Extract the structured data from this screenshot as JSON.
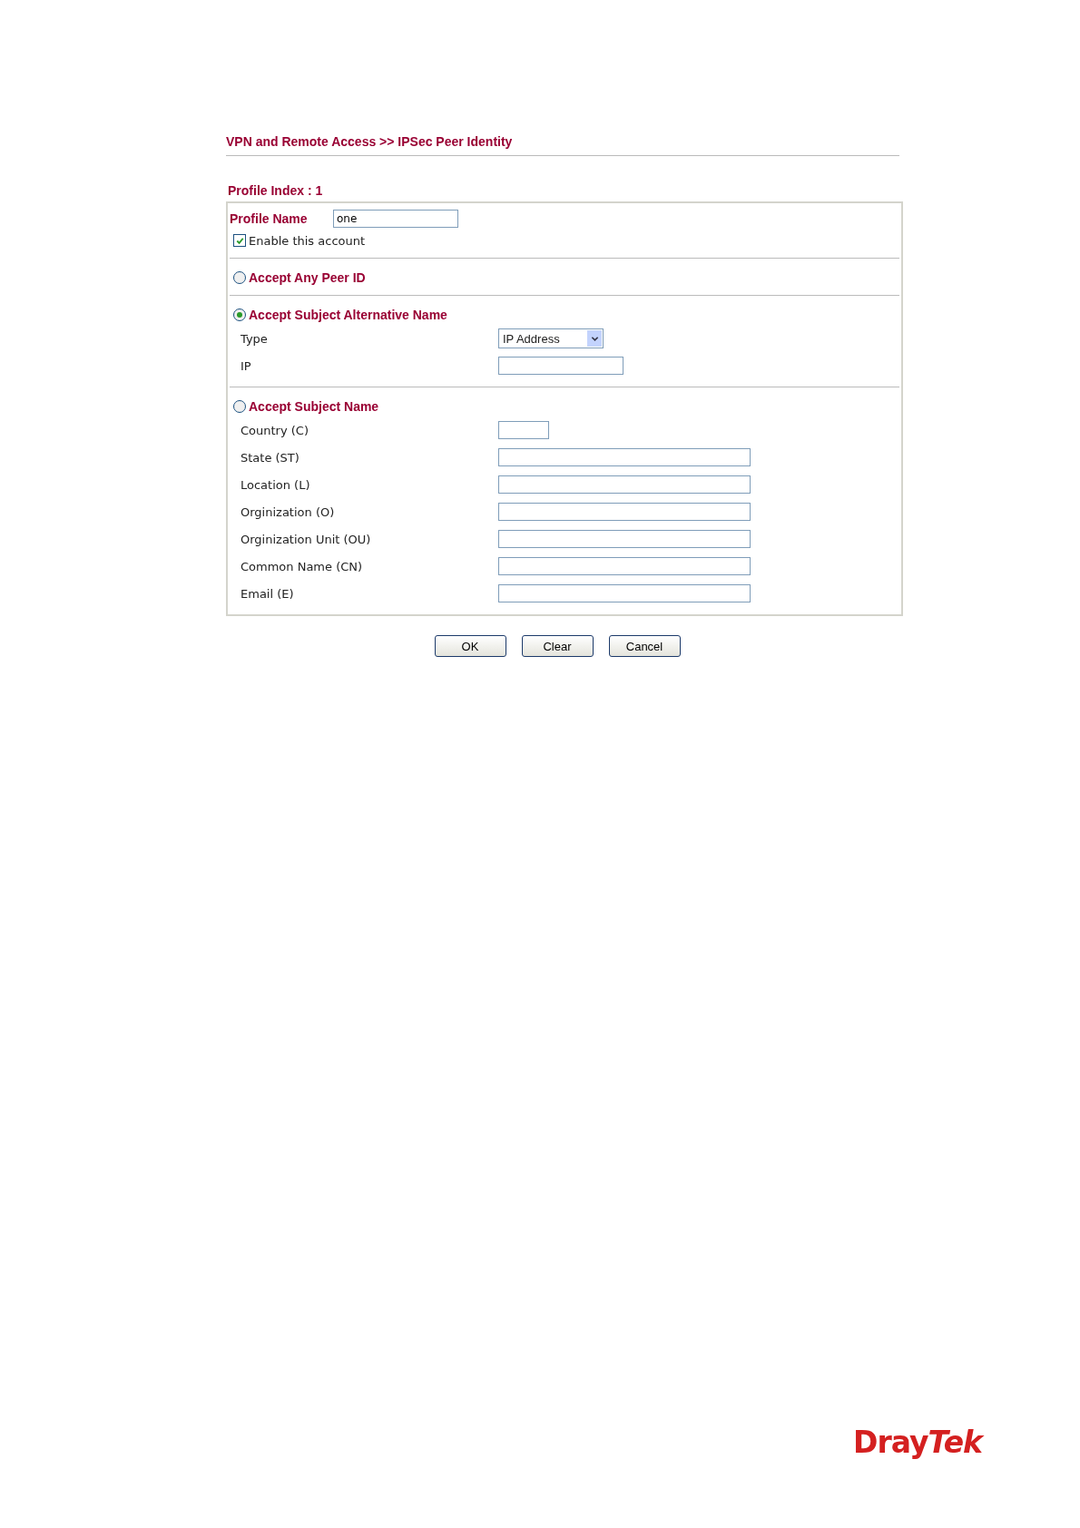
{
  "breadcrumb": "VPN and Remote Access >> IPSec Peer Identity",
  "profile_index": "Profile Index : 1",
  "profile_name": {
    "label": "Profile Name",
    "value": "one"
  },
  "enable_account": {
    "label": "Enable this account",
    "checked": true
  },
  "sections": [
    {
      "label": "Accept Any Peer ID",
      "selected": false
    },
    {
      "label": "Accept Subject Alternative Name",
      "selected": true,
      "fields": [
        {
          "kind": "select",
          "label": "Type",
          "value": "IP Address"
        },
        {
          "kind": "medium",
          "label": "IP"
        }
      ]
    },
    {
      "label": "Accept Subject Name",
      "selected": false,
      "fields": [
        {
          "kind": "short",
          "label": "Country (C)"
        },
        {
          "kind": "long",
          "label": "State (ST)"
        },
        {
          "kind": "long",
          "label": "Location (L)"
        },
        {
          "kind": "long",
          "label": "Orginization (O)"
        },
        {
          "kind": "long",
          "label": "Orginization Unit (OU)"
        },
        {
          "kind": "long",
          "label": "Common Name (CN)"
        },
        {
          "kind": "long",
          "label": "Email (E)"
        }
      ]
    }
  ],
  "buttons": [
    "OK",
    "Clear",
    "Cancel"
  ],
  "logo": {
    "upright": "Dray",
    "italic": "Tek"
  }
}
